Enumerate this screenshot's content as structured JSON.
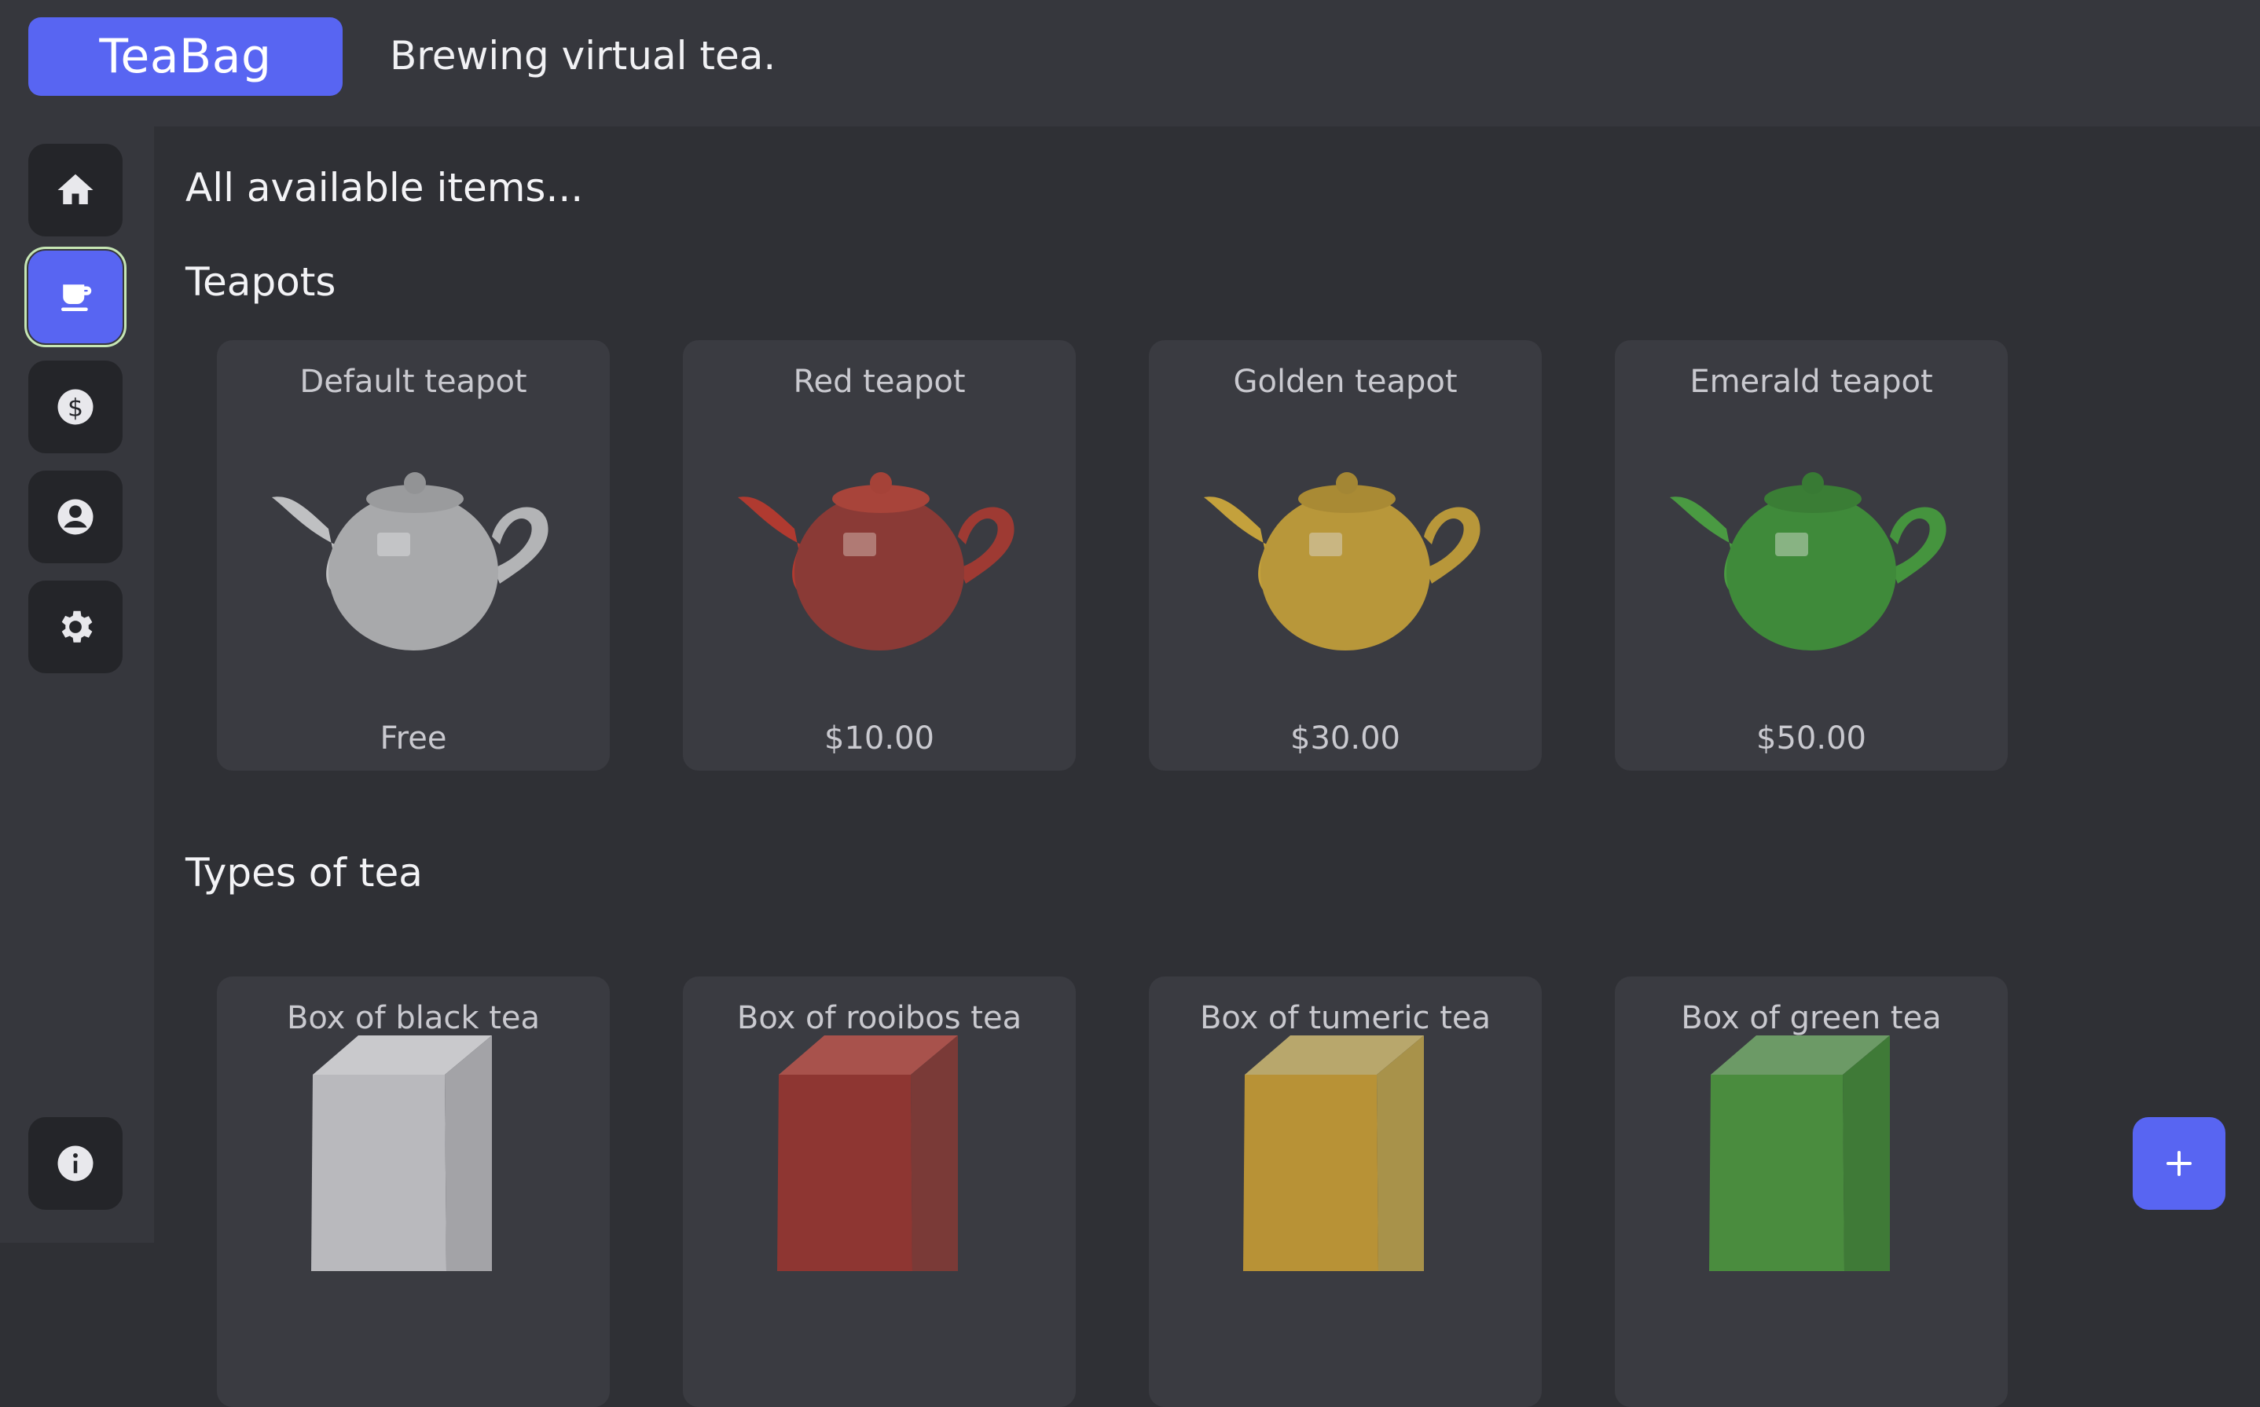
{
  "header": {
    "brand": "TeaBag",
    "tagline": "Brewing virtual tea."
  },
  "sidebar": {
    "items": [
      {
        "icon": "home-icon",
        "active": false
      },
      {
        "icon": "teacup-icon",
        "active": true
      },
      {
        "icon": "dollar-icon",
        "active": false
      },
      {
        "icon": "account-icon",
        "active": false
      },
      {
        "icon": "gear-icon",
        "active": false
      }
    ],
    "info_icon": "info-icon"
  },
  "main": {
    "title": "All available items...",
    "teapots": {
      "heading": "Teapots",
      "items": [
        {
          "name": "Default teapot",
          "price": "Free",
          "color": "#a8a9ab"
        },
        {
          "name": "Red teapot",
          "price": "$10.00",
          "color": "#8a3a36"
        },
        {
          "name": "Golden teapot",
          "price": "$30.00",
          "color": "#b8973a"
        },
        {
          "name": "Emerald teapot",
          "price": "$50.00",
          "color": "#3f8a3a"
        }
      ]
    },
    "teas": {
      "heading": "Types of tea",
      "items": [
        {
          "name": "Box of black tea",
          "color": "#b9b9bd"
        },
        {
          "name": "Box of rooibos tea",
          "color": "#8e3632"
        },
        {
          "name": "Box of tumeric tea",
          "color": "#b89236"
        },
        {
          "name": "Box of green tea",
          "color": "#4a8c3e"
        }
      ]
    }
  },
  "fab": {
    "icon": "plus-icon"
  },
  "colors": {
    "accent": "#5865f2",
    "background": "#2f3035",
    "panel": "#36373d",
    "card": "#3a3b41"
  }
}
